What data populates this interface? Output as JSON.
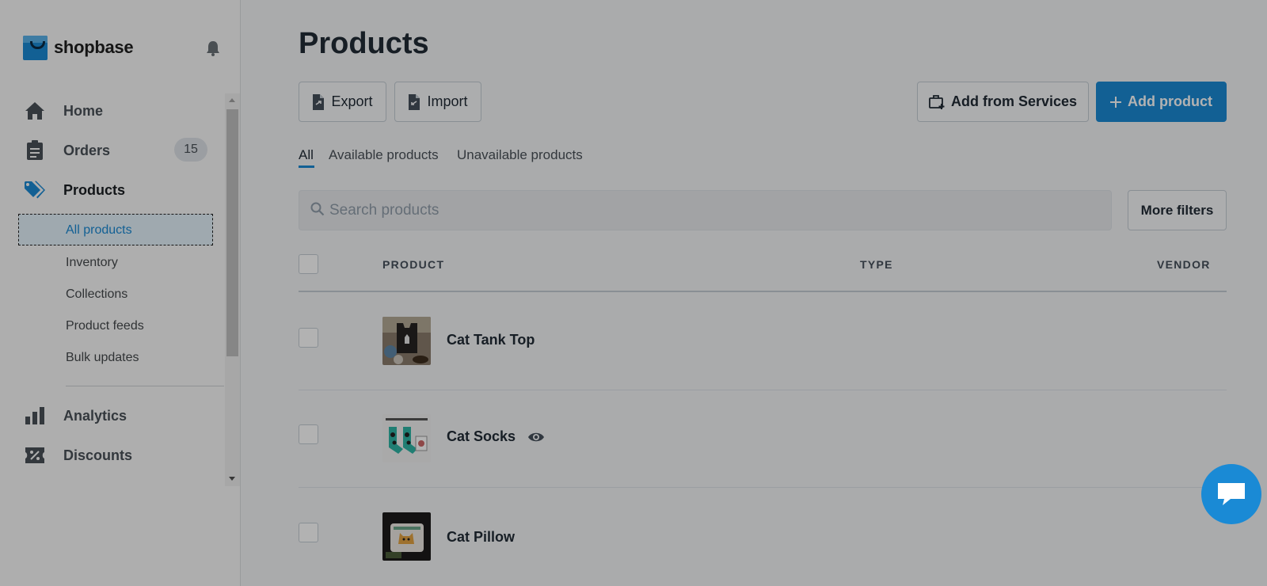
{
  "brand": {
    "name": "shopbase"
  },
  "sidebar": {
    "items": [
      {
        "label": "Home",
        "icon": "home-icon"
      },
      {
        "label": "Orders",
        "icon": "clipboard-icon",
        "badge": "15"
      },
      {
        "label": "Products",
        "icon": "tags-icon"
      },
      {
        "label": "Analytics",
        "icon": "bar-chart-icon"
      },
      {
        "label": "Discounts",
        "icon": "discount-icon"
      }
    ],
    "product_sub_items": [
      "All products",
      "Inventory",
      "Collections",
      "Product feeds",
      "Bulk updates"
    ]
  },
  "main": {
    "title": "Products",
    "buttons": {
      "export": "Export",
      "import": "Import",
      "add_from_services": "Add from Services",
      "add_product": "Add product",
      "more_filters": "More filters"
    },
    "tabs": [
      "All",
      "Available products",
      "Unavailable products"
    ],
    "search": {
      "placeholder": "Search products",
      "value": ""
    },
    "table": {
      "headers": [
        "PRODUCT",
        "TYPE",
        "VENDOR"
      ],
      "rows": [
        {
          "name": "Cat Tank Top",
          "type": "",
          "vendor": ""
        },
        {
          "name": "Cat Socks",
          "type": "",
          "vendor": "",
          "icon": "eye-icon"
        },
        {
          "name": "Cat Pillow",
          "type": "",
          "vendor": ""
        }
      ]
    }
  },
  "colors": {
    "accent": "#1a8ad5",
    "overlay": "rgba(0,0,0,0.30)"
  }
}
